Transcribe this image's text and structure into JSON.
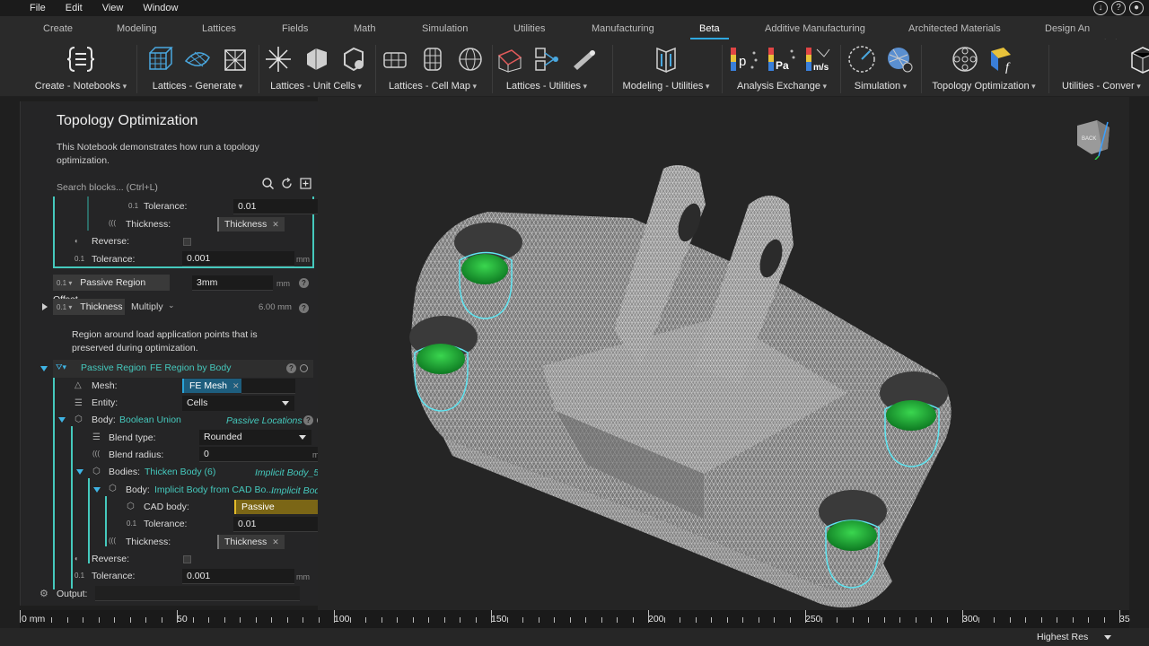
{
  "menu": [
    "File",
    "Edit",
    "View",
    "Window"
  ],
  "tabs": [
    {
      "label": "Create"
    },
    {
      "label": "Modeling"
    },
    {
      "label": "Lattices"
    },
    {
      "label": "Fields"
    },
    {
      "label": "Math"
    },
    {
      "label": "Simulation"
    },
    {
      "label": "Utilities"
    },
    {
      "label": "Manufacturing"
    },
    {
      "label": "Beta"
    },
    {
      "label": "Additive Manufacturing"
    },
    {
      "label": "Architected Materials"
    },
    {
      "label": "Design An"
    }
  ],
  "active_tab": "Beta",
  "ribbon_groups": [
    {
      "label": "Create - Notebooks"
    },
    {
      "label": "Lattices - Generate"
    },
    {
      "label": "Lattices - Unit Cells"
    },
    {
      "label": "Lattices - Cell Map"
    },
    {
      "label": "Lattices - Utilities"
    },
    {
      "label": "Modeling - Utilities"
    },
    {
      "label": "Analysis Exchange"
    },
    {
      "label": "Simulation"
    },
    {
      "label": "Topology Optimization"
    },
    {
      "label": "Utilities - Conver"
    }
  ],
  "ribbon_icon_text": {
    "p": "p",
    "pa": "Pa",
    "ms": "m/s",
    "f": "f"
  },
  "panel": {
    "title": "Topology Optimization",
    "description": "This Notebook demonstrates how run a topology optimization.",
    "search_placeholder": "Search blocks... (Ctrl+L)",
    "top": {
      "tolerance_label": "Tolerance:",
      "tolerance_value": "0.01",
      "unit_mm": "mm",
      "thickness_label": "Thickness:",
      "thickness_chip": "Thickness",
      "reverse_label": "Reverse:",
      "tolerance2_label": "Tolerance:",
      "tolerance2_value": "0.001"
    },
    "offset": {
      "label": "Passive Region Offset",
      "value": "3mm",
      "unit": "mm"
    },
    "thickness_row": {
      "label": "Thickness",
      "mode": "Multiply",
      "value": "6.00 mm"
    },
    "region_note": "Region around load application points that is preserved during optimization.",
    "passive": {
      "label": "Passive Region",
      "type": "FE Region by Body",
      "mesh_label": "Mesh:",
      "mesh_chip": "FE Mesh",
      "entity_label": "Entity:",
      "entity_value": "Cells",
      "body_label": "Body:",
      "body_value": "Boolean Union",
      "body_name": "Passive Locations",
      "blend_type_label": "Blend type:",
      "blend_type_value": "Rounded",
      "blend_radius_label": "Blend radius:",
      "blend_radius_value": "0",
      "bodies_label": "Bodies:",
      "bodies_value": "Thicken Body (6)",
      "bodies_name": "Implicit Body_5",
      "body2_label": "Body:",
      "body2_value": "Implicit Body from CAD Bo...",
      "body2_name": "Implicit Body_...",
      "cad_label": "CAD body:",
      "cad_chip": "Passive Faces",
      "tol_label": "Tolerance:",
      "tol_value": "0.01",
      "thick_label": "Thickness:",
      "thick_chip": "Thickness",
      "reverse_label": "Reverse:",
      "tol2_label": "Tolerance:",
      "tol2_value": "0.001"
    },
    "output_label": "Output:"
  },
  "ruler": {
    "unit_label": "0 mm",
    "labels": [
      "50",
      "100",
      "150",
      "200",
      "250",
      "300",
      "35"
    ]
  },
  "resolution": "Highest Res",
  "navcube_label": "BACK",
  "colors": {
    "accent": "#2fa8e0",
    "teal": "#45c9bd",
    "mesh": "#8c8c8c",
    "passive_green": "#22a23a",
    "cyan_outline": "#5fe4f0"
  }
}
